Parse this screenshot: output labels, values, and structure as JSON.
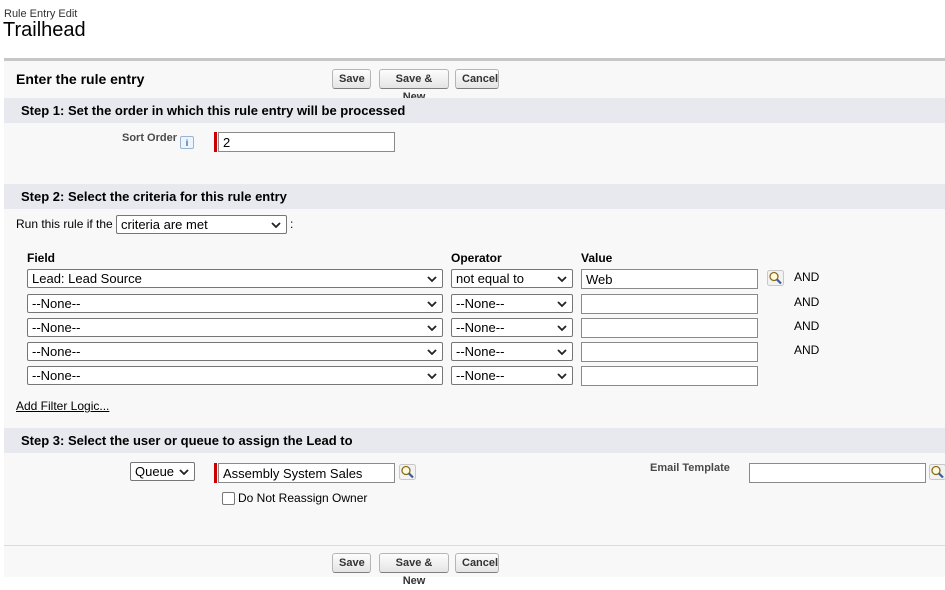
{
  "page": {
    "breadcrumb": "Rule Entry Edit",
    "title": "Trailhead"
  },
  "panel": {
    "title": "Enter the rule entry"
  },
  "buttons": {
    "save": "Save",
    "save_new": "Save & New",
    "cancel": "Cancel"
  },
  "step1": {
    "header": "Step 1: Set the order in which this rule entry will be processed",
    "sort_order_label": "Sort Order",
    "info_icon": "i",
    "sort_order_value": "2"
  },
  "step2": {
    "header": "Step 2: Select the criteria for this rule entry",
    "run_label": "Run this rule if the",
    "run_value": "criteria are met",
    "run_suffix": ":",
    "columns": {
      "field": "Field",
      "operator": "Operator",
      "value": "Value"
    },
    "rows": [
      {
        "field": "Lead: Lead Source",
        "operator": "not equal to",
        "value": "Web",
        "conj": "AND"
      },
      {
        "field": "--None--",
        "operator": "--None--",
        "value": "",
        "conj": "AND"
      },
      {
        "field": "--None--",
        "operator": "--None--",
        "value": "",
        "conj": "AND"
      },
      {
        "field": "--None--",
        "operator": "--None--",
        "value": "",
        "conj": "AND"
      },
      {
        "field": "--None--",
        "operator": "--None--",
        "value": "",
        "conj": ""
      }
    ],
    "add_filter_logic": "Add Filter Logic..."
  },
  "step3": {
    "header": "Step 3: Select the user or queue to assign the Lead to",
    "assignee_type": "Queue",
    "assignee_value": "Assembly System Sales",
    "do_not_reassign_label": "Do Not Reassign Owner",
    "do_not_reassign_checked": false,
    "email_template_label": "Email Template",
    "email_template_value": ""
  },
  "icons": {
    "lookup": "lookup-magnifier-icon",
    "chevron": "chevron-down-icon",
    "info": "info-icon"
  },
  "colors": {
    "required_bar": "#cc0000",
    "section_header_bg": "#e7e9ef",
    "panel_border": "#c7c7c7"
  }
}
